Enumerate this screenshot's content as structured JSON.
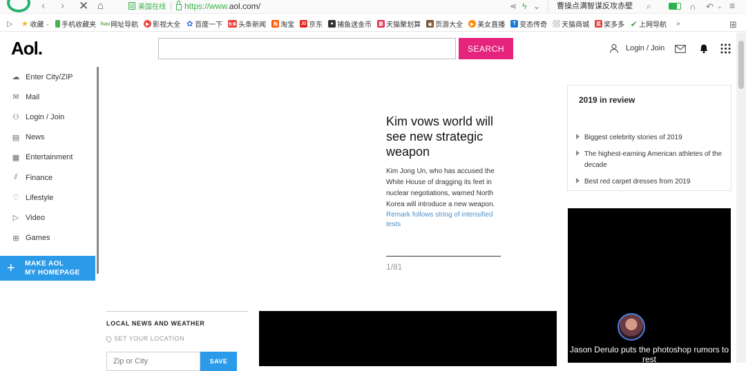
{
  "browser": {
    "cert_label": "美国在线",
    "url_scheme": "https://www.",
    "url_domain": "aol.com/",
    "news_ticker": "曹操点满智谋反攻赤壁",
    "bookmarks": [
      {
        "label": "收藏",
        "icon": "star-icon",
        "color": "#f3b21a"
      },
      {
        "label": "手机收藏夹",
        "icon": "phone-icon",
        "color": "#4caf50"
      },
      {
        "label": "网址导航",
        "icon": "hao-icon",
        "color": "#6ab04c"
      },
      {
        "label": "影视大全",
        "icon": "play-icon",
        "color": "#e84a3c"
      },
      {
        "label": "百度一下",
        "icon": "paw-icon",
        "color": "#2e6ee6"
      },
      {
        "label": "头条新闻",
        "icon": "toutiao-icon",
        "color": "#e53935"
      },
      {
        "label": "淘宝",
        "icon": "taobao-icon",
        "color": "#ff5000"
      },
      {
        "label": "京东",
        "icon": "jd-icon",
        "color": "#e1251b"
      },
      {
        "label": "捕鱼送金币",
        "icon": "fish-icon",
        "color": "#333333"
      },
      {
        "label": "天猫聚划算",
        "icon": "tmall-icon",
        "color": "#e12a4b"
      },
      {
        "label": "页游大全",
        "icon": "game-icon",
        "color": "#7a5230"
      },
      {
        "label": "美女直播",
        "icon": "live-icon",
        "color": "#ff8a00"
      },
      {
        "label": "变态传奇",
        "icon": "t-icon",
        "color": "#1a7ad8"
      },
      {
        "label": "天猫商城",
        "icon": "shop-icon",
        "color": "#b0b0b0"
      },
      {
        "label": "奖多多",
        "icon": "prize-icon",
        "color": "#e53935"
      },
      {
        "label": "上网导航",
        "icon": "check-icon",
        "color": "#43a047"
      }
    ],
    "more": "»"
  },
  "header": {
    "logo": "Aol.",
    "search_value": "",
    "search_button": "SEARCH",
    "login": "Login / Join"
  },
  "sidebar": {
    "items": [
      {
        "label": "Enter City/ZIP",
        "icon": "weather-icon",
        "glyph": "☁"
      },
      {
        "label": "Mail",
        "icon": "mail-icon",
        "glyph": "✉"
      },
      {
        "label": "Login / Join",
        "icon": "user-icon",
        "glyph": "⚇"
      },
      {
        "label": "News",
        "icon": "news-icon",
        "glyph": "▤"
      },
      {
        "label": "Entertainment",
        "icon": "clapper-icon",
        "glyph": "▦"
      },
      {
        "label": "Finance",
        "icon": "chart-icon",
        "glyph": "⫽"
      },
      {
        "label": "Lifestyle",
        "icon": "heart-icon",
        "glyph": "♡"
      },
      {
        "label": "Video",
        "icon": "video-icon",
        "glyph": "▷"
      },
      {
        "label": "Games",
        "icon": "gamepad-icon",
        "glyph": "⊞"
      }
    ],
    "homepage_line1": "MAKE AOL",
    "homepage_line2": "MY HOMEPAGE"
  },
  "article": {
    "title": "Kim vows world will see new strategic weapon",
    "body": "Kim Jong Un, who has accused the White House of dragging its feet in nuclear negotiations, warned North Korea will introduce a new weapon.",
    "link": "Remark follows string of intensified tests",
    "slide_count": "1/81"
  },
  "review": {
    "title": "2019 in review",
    "items": [
      "Biggest celebrity stories of 2019",
      "The highest-earning American athletes of the decade",
      "Best red carpet dresses from 2019"
    ]
  },
  "video": {
    "caption": "Jason Derulo puts the photoshop rumors to rest"
  },
  "local": {
    "title": "LOCAL NEWS AND WEATHER",
    "subtitle": "SET YOUR LOCATION",
    "zip_placeholder": "Zip or City",
    "save": "SAVE"
  }
}
